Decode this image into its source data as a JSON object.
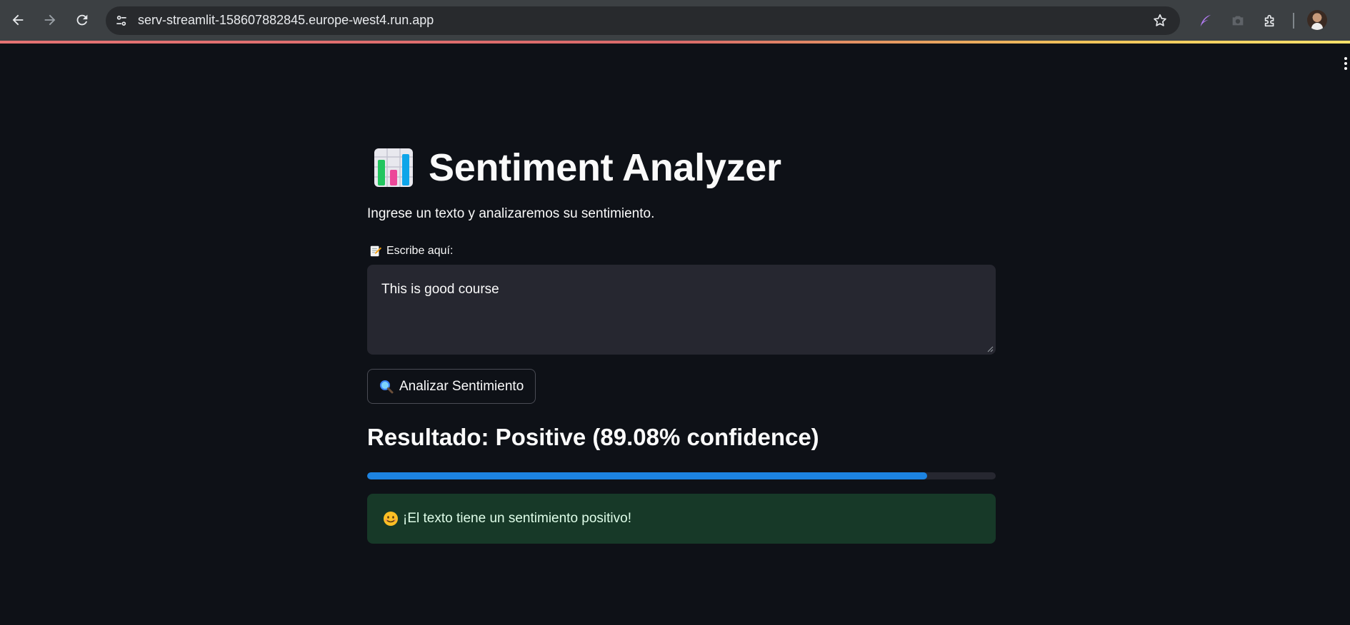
{
  "browser": {
    "url": "serv-streamlit-158607882845.europe-west4.run.app",
    "icons": [
      "back-arrow-icon",
      "forward-arrow-icon",
      "reload-icon",
      "site-settings-icon",
      "bookmark-star-icon",
      "quill-extension-icon",
      "camera-icon",
      "extensions-puzzle-icon",
      "profile-avatar"
    ]
  },
  "app": {
    "title": "Sentiment Analyzer",
    "title_icon": "bar-chart-icon",
    "subtitle": "Ingrese un texto y analizaremos su sentimiento.",
    "input": {
      "label": "Escribe aquí:",
      "label_icon": "memo-icon",
      "value": "This is good course"
    },
    "button": {
      "label": "Analizar Sentimiento",
      "icon": "search-icon"
    },
    "result": {
      "heading": "Resultado: Positive (89.08% confidence)",
      "confidence_percent": 89.08
    },
    "alert": {
      "message": "¡El texto tiene un sentimiento positivo!",
      "icon": "smile-icon"
    }
  },
  "colors": {
    "background": "#0e1117",
    "input_bg": "#262730",
    "progress": "#1c83e1",
    "success_bg": "#173928",
    "success_text": "#dffde9"
  }
}
